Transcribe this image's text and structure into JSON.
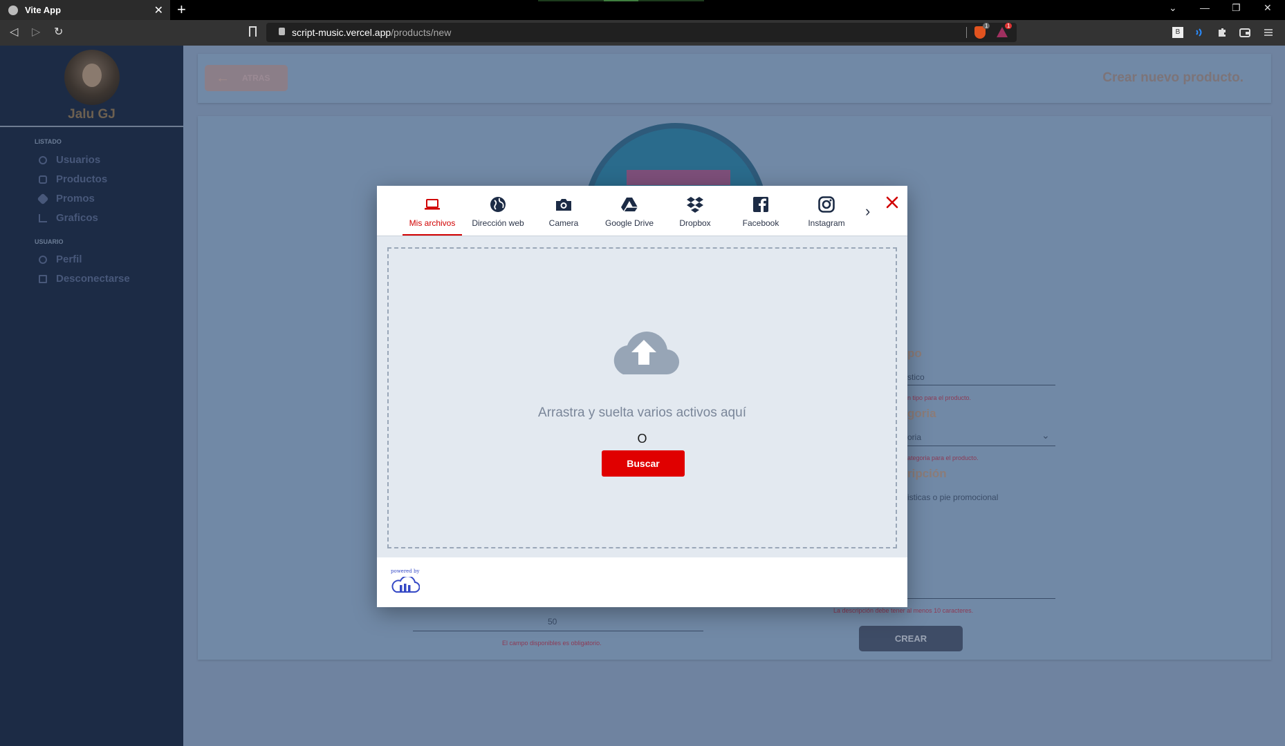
{
  "browser": {
    "tab_title": "Vite App",
    "tab_close": "✕",
    "new_tab": "+",
    "url_host": "script-music.vercel.app",
    "url_path": "/products/new",
    "shield_badge": "1",
    "bat_badge": "1",
    "win_dropdown": "⌄",
    "win_minimize": "—",
    "win_restore": "❐",
    "win_close": "✕",
    "ext_b": "B"
  },
  "sidebar": {
    "user_name": "Jalu GJ",
    "sections": [
      {
        "title": "LISTADO",
        "items": [
          {
            "label": "Usuarios",
            "icon": "user-icon"
          },
          {
            "label": "Productos",
            "icon": "store-icon"
          },
          {
            "label": "Promos",
            "icon": "tag-icon"
          },
          {
            "label": "Graficos",
            "icon": "bar-chart-icon"
          }
        ]
      },
      {
        "title": "USUARIO",
        "items": [
          {
            "label": "Perfil",
            "icon": "profile-icon"
          },
          {
            "label": "Desconectarse",
            "icon": "logout-icon"
          }
        ]
      }
    ]
  },
  "header": {
    "back_label": "ATRAS",
    "page_title": "Crear nuevo producto."
  },
  "form_background": {
    "label_tipo": "po",
    "input_tipo": "stico",
    "err_tipo": "n tipo para el producto.",
    "label_categoria": "goria",
    "input_categoria": "oria",
    "err_categoria": "ategoria para el producto.",
    "label_descripcion": "ripción",
    "input_descripcion": "isticas o pie promocional",
    "err_descripcion": "La descripción debe tener al menos 10 caracteres.",
    "disponibles_value": "50",
    "err_disponibles": "El campo disponibles es obligatorio.",
    "create_label": "CREAR"
  },
  "upload_modal": {
    "tabs": [
      {
        "label": "Mis archivos",
        "icon": "laptop-icon",
        "active": true
      },
      {
        "label": "Dirección web",
        "icon": "globe-icon",
        "active": false
      },
      {
        "label": "Camera",
        "icon": "camera-icon",
        "active": false
      },
      {
        "label": "Google Drive",
        "icon": "google-drive-icon",
        "active": false
      },
      {
        "label": "Dropbox",
        "icon": "dropbox-icon",
        "active": false
      },
      {
        "label": "Facebook",
        "icon": "facebook-icon",
        "active": false
      },
      {
        "label": "Instagram",
        "icon": "instagram-icon",
        "active": false
      }
    ],
    "next_label": "›",
    "drop_text": "Arrastra y suelta varios activos aquí",
    "or_text": "O",
    "search_label": "Buscar",
    "powered_by": "powered by"
  },
  "colors": {
    "accent_red": "#e00000",
    "sidebar_bg": "#1c2b45",
    "overlay_bg": "#6f83a0",
    "modal_body_bg": "#e3e9f0"
  }
}
